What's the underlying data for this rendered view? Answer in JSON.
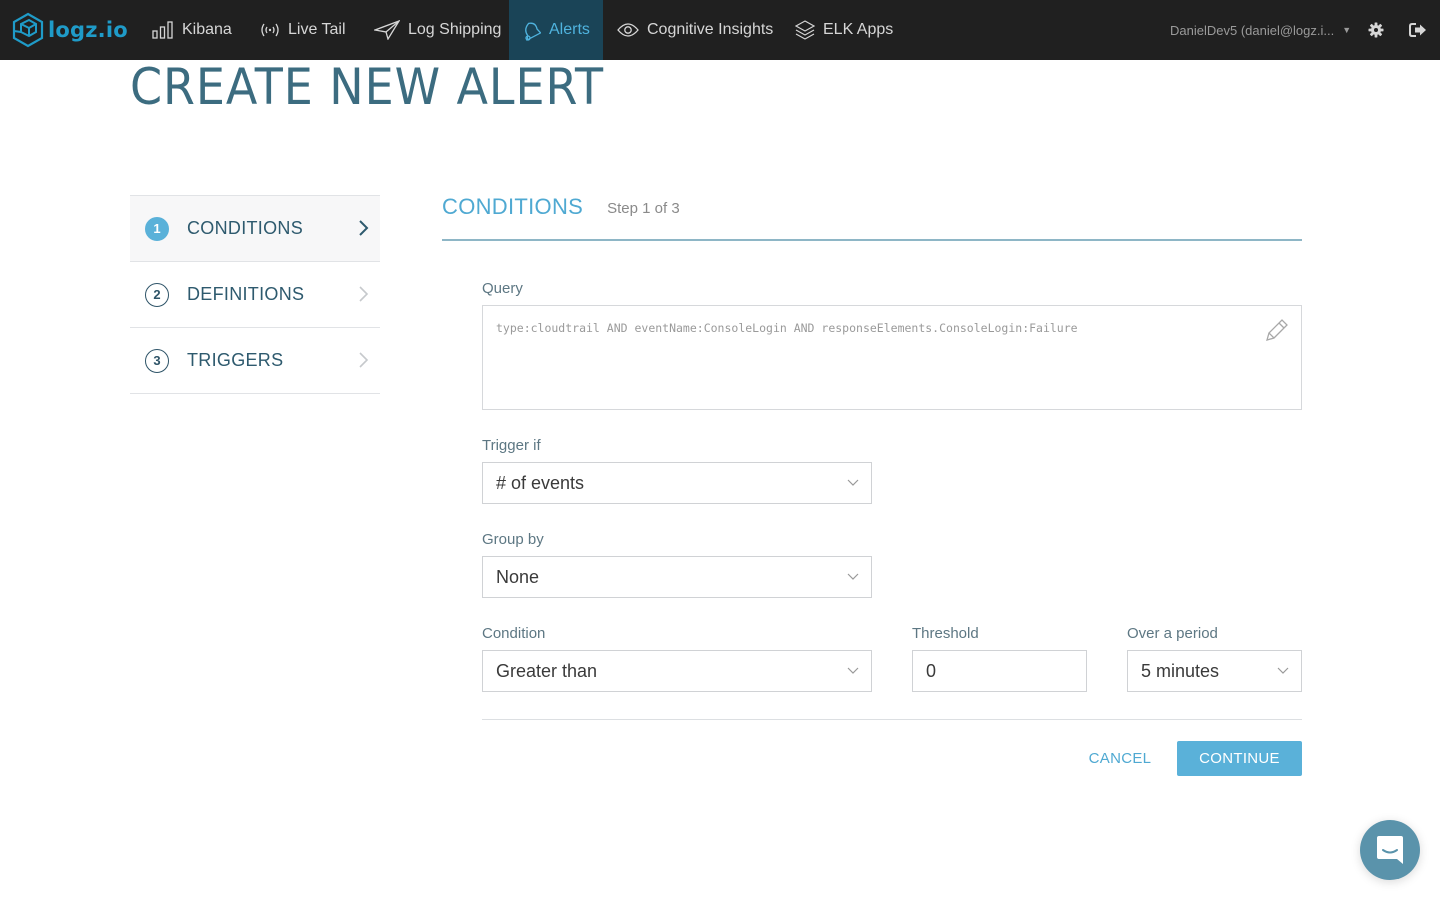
{
  "nav": {
    "brand": "logz.io",
    "items": [
      {
        "label": "Kibana",
        "icon": "bar-chart-icon",
        "active": false
      },
      {
        "label": "Live Tail",
        "icon": "broadcast-icon",
        "active": false
      },
      {
        "label": "Log Shipping",
        "icon": "paper-plane-icon",
        "active": false
      },
      {
        "label": "Alerts",
        "icon": "bell-icon",
        "active": true
      },
      {
        "label": "Cognitive Insights",
        "icon": "eye-icon",
        "active": false
      },
      {
        "label": "ELK Apps",
        "icon": "layers-icon",
        "active": false
      }
    ],
    "user": "DanielDev5 (daniel@logz.i...",
    "settings_icon": "gear-icon",
    "logout_icon": "logout-icon"
  },
  "page": {
    "title": "CREATE NEW ALERT"
  },
  "steps": [
    {
      "number": "1",
      "label": "CONDITIONS",
      "active": true
    },
    {
      "number": "2",
      "label": "DEFINITIONS",
      "active": false
    },
    {
      "number": "3",
      "label": "TRIGGERS",
      "active": false
    }
  ],
  "section": {
    "title": "CONDITIONS",
    "step_text": "Step 1 of 3"
  },
  "form": {
    "query_label": "Query",
    "query_value": "type:cloudtrail AND eventName:ConsoleLogin AND responseElements.ConsoleLogin:Failure",
    "trigger_if_label": "Trigger if",
    "trigger_if_value": "# of events",
    "group_by_label": "Group by",
    "group_by_value": "None",
    "condition_label": "Condition",
    "condition_value": "Greater than",
    "threshold_label": "Threshold",
    "threshold_value": "0",
    "period_label": "Over a period",
    "period_value": "5 minutes"
  },
  "actions": {
    "cancel": "CANCEL",
    "continue": "CONTINUE"
  },
  "colors": {
    "accent": "#5ab1d9",
    "nav_bg": "#202020",
    "nav_active_bg": "#1a4457",
    "brand": "#1f9bc8",
    "title": "#3c6c80"
  }
}
